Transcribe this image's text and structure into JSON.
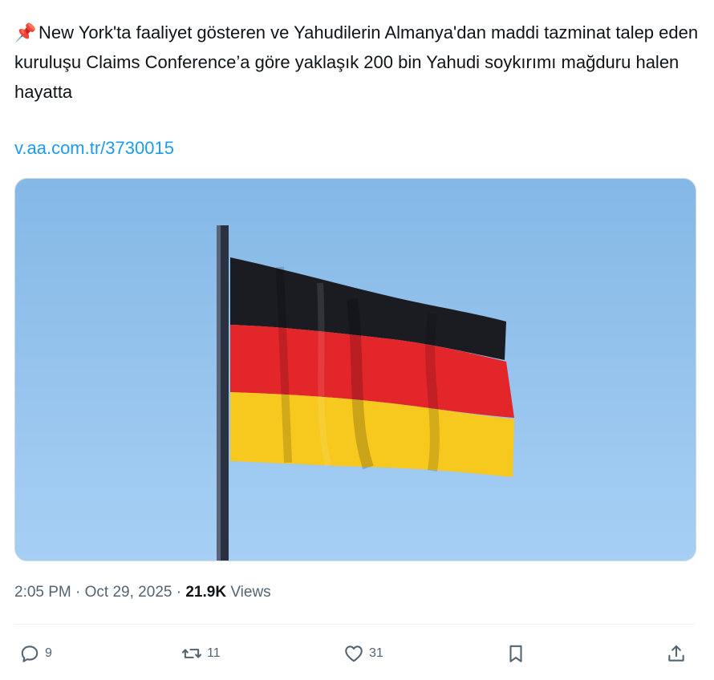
{
  "tweet": {
    "pin_emoji": "📌",
    "text": "New York'ta faaliyet gösteren ve Yahudilerin Almanya'dan maddi tazminat talep eden kuruluşu Claims Conference’a göre yaklaşık 200 bin Yahudi soykırımı mağduru halen hayatta",
    "link": "v.aa.com.tr/3730015"
  },
  "media": {
    "description_icon": "german-flag-photo",
    "colors": {
      "sky": "#9fcaf1",
      "black": "#1a1c22",
      "red": "#e2262a",
      "gold": "#f7c81e",
      "pole": "#2a3140"
    }
  },
  "meta": {
    "time": "2:05 PM",
    "separator": "·",
    "date": "Oct 29, 2025",
    "separator2": "·",
    "views_count": "21.9K",
    "views_label": "Views"
  },
  "actions": {
    "reply_count": "9",
    "retweet_count": "11",
    "like_count": "31"
  },
  "colors": {
    "link": "#1d9bf0",
    "muted": "#536471",
    "text": "#0f1419"
  }
}
